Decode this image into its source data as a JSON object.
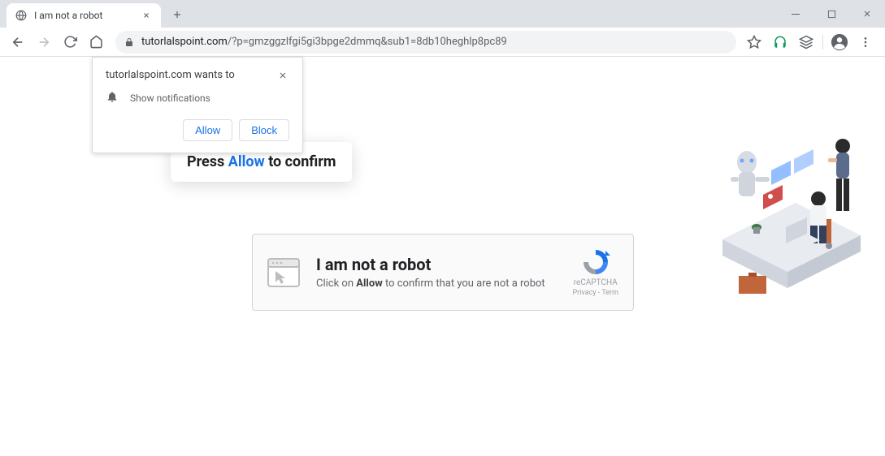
{
  "browser": {
    "tab": {
      "title": "I am not a robot"
    },
    "url": {
      "domain": "tutorlalspoint.com",
      "path": "/?p=gmzggzlfgi5gi3bpge2dmmq&sub1=8db10heghlp8pc89"
    }
  },
  "notification_popup": {
    "title": "tutorlalspoint.com wants to",
    "permission_text": "Show notifications",
    "allow_label": "Allow",
    "block_label": "Block"
  },
  "callout": {
    "prefix": "Press ",
    "highlight": "Allow",
    "suffix": " to confirm"
  },
  "captcha": {
    "heading": "I am not a robot",
    "sub_prefix": "Click on ",
    "sub_bold": "Allow",
    "sub_suffix": " to confirm that you are not a robot",
    "recaptcha_label": "reCAPTCHA",
    "recaptcha_links": "Privacy - Term"
  }
}
